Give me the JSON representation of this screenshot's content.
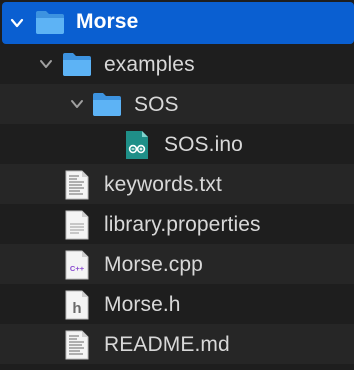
{
  "tree": {
    "root": {
      "label": "Morse",
      "icon": "folder-icon",
      "expanded": true
    },
    "examples": {
      "label": "examples",
      "icon": "folder-icon",
      "expanded": true
    },
    "sos_folder": {
      "label": "SOS",
      "icon": "folder-icon",
      "expanded": true
    },
    "sos_ino": {
      "label": "SOS.ino",
      "icon": "arduino-file-icon"
    },
    "keywords": {
      "label": "keywords.txt",
      "icon": "text-file-icon"
    },
    "library": {
      "label": "library.properties",
      "icon": "document-file-icon"
    },
    "morse_cpp": {
      "label": "Morse.cpp",
      "icon": "cpp-file-icon",
      "badge": "C++"
    },
    "morse_h": {
      "label": "Morse.h",
      "icon": "header-file-icon",
      "badge": "h"
    },
    "readme": {
      "label": "README.md",
      "icon": "text-file-icon"
    }
  },
  "colors": {
    "background": "#1e1e1e",
    "selection": "#0a5fd1",
    "folder": "#4aa6f0",
    "arduino": "#2aa198"
  }
}
